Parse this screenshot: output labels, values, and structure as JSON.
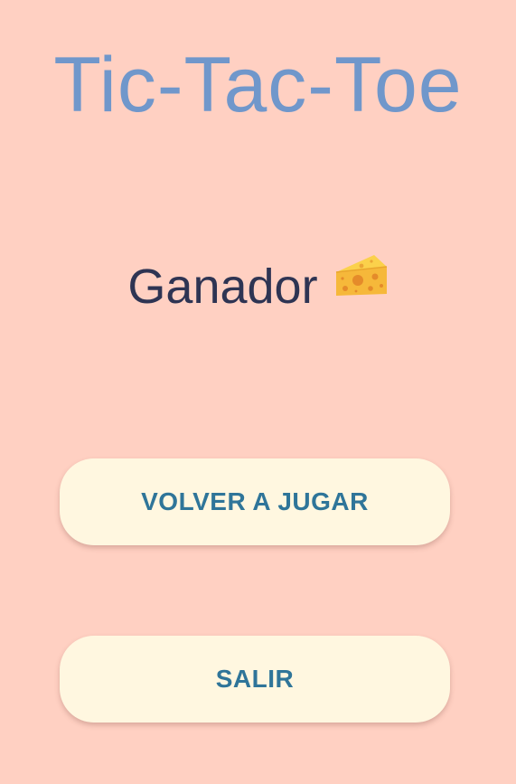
{
  "app": {
    "title": "Tic-Tac-Toe"
  },
  "result": {
    "label": "Ganador",
    "winner_icon": "cheese-icon"
  },
  "buttons": {
    "replay_label": "VOLVER A JUGAR",
    "exit_label": "SALIR"
  },
  "colors": {
    "background": "#FFD0C2",
    "title": "#7097CB",
    "result_text": "#2E3453",
    "button_background": "#FFF7E0",
    "button_text": "#2F7599"
  }
}
